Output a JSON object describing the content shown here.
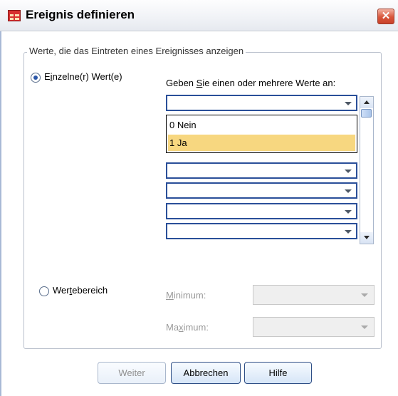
{
  "window": {
    "title": "Ereignis definieren"
  },
  "group": {
    "legend": "Werte, die das Eintreten eines Ereignisses anzeigen"
  },
  "single": {
    "radio_label_pre": "E",
    "radio_label_mn": "i",
    "radio_label_post": "nzelne(r) Wert(e)",
    "selected": true,
    "instruction_pre": "Geben ",
    "instruction_mn": "S",
    "instruction_post": "ie einen oder mehrere Werte an:",
    "combo_values": [
      "",
      "",
      "",
      "",
      "",
      "",
      ""
    ],
    "options": [
      "0 Nein",
      "1 Ja"
    ],
    "highlighted_option": "1 Ja"
  },
  "range": {
    "radio_label_pre": "Wer",
    "radio_label_mn": "t",
    "radio_label_post": "ebereich",
    "selected": false,
    "min_label_pre": "",
    "min_label_mn": "M",
    "min_label_post": "inimum:",
    "max_label_pre": "Ma",
    "max_label_mn": "x",
    "max_label_post": "imum:",
    "min_value": "",
    "max_value": ""
  },
  "buttons": {
    "continue": "Weiter",
    "cancel": "Abbrechen",
    "help": "Hilfe"
  }
}
